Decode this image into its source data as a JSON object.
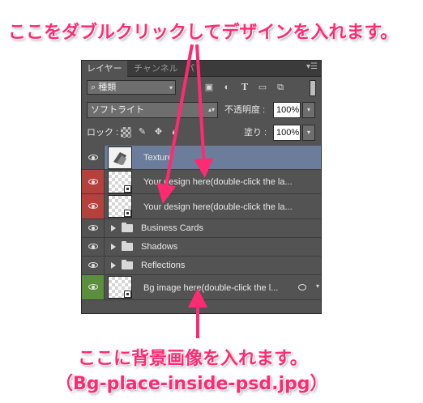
{
  "annotations": {
    "top": "ここをダブルクリックしてデザインを入れます。",
    "bottom_line1": "ここに背景画像を入れます。",
    "bottom_line2": "（Bg-place-inside-psd.jpg）"
  },
  "panel": {
    "tabs": [
      "レイヤー",
      "チャンネル",
      "パス"
    ],
    "menu_icon": "panel-menu-icon",
    "kind_filter": {
      "label": "種類",
      "icon": "search-icon"
    },
    "filter_icons": [
      "pixel-filter-icon",
      "adjustment-filter-icon",
      "type-filter-icon",
      "shape-filter-icon",
      "smart-object-filter-icon"
    ],
    "type_filter_glyph": "T",
    "blend_mode": "ソフトライト",
    "opacity_label": "不透明度 :",
    "opacity_value": "100%",
    "lock_label": "ロック :",
    "lock_icons": [
      "lock-transparent-icon",
      "lock-paint-icon",
      "lock-position-icon",
      "lock-all-icon"
    ],
    "fill_label": "塗り :",
    "fill_value": "100%"
  },
  "layers": [
    {
      "name": "Texture",
      "type": "image",
      "eye_color": "#535353",
      "row_color": "#6b7d9a",
      "selected": true
    },
    {
      "name": "Your design here(double-click the la...",
      "type": "smart",
      "eye_color": "#b5413d"
    },
    {
      "name": "Your design here(double-click the la...",
      "type": "smart",
      "eye_color": "#b5413d"
    },
    {
      "name": "Business Cards",
      "type": "group",
      "eye_color": "#535353"
    },
    {
      "name": "Shadows",
      "type": "group",
      "eye_color": "#535353"
    },
    {
      "name": "Reflections",
      "type": "group",
      "eye_color": "#535353"
    },
    {
      "name": "Bg image here(double-click the l...",
      "type": "smart",
      "eye_color": "#5b8f3b",
      "has_fx": true
    }
  ],
  "colors": {
    "annotation": "#ff2a72",
    "selected_row": "#6b7d9a",
    "red_label": "#b5413d",
    "green_label": "#5b8f3b"
  }
}
